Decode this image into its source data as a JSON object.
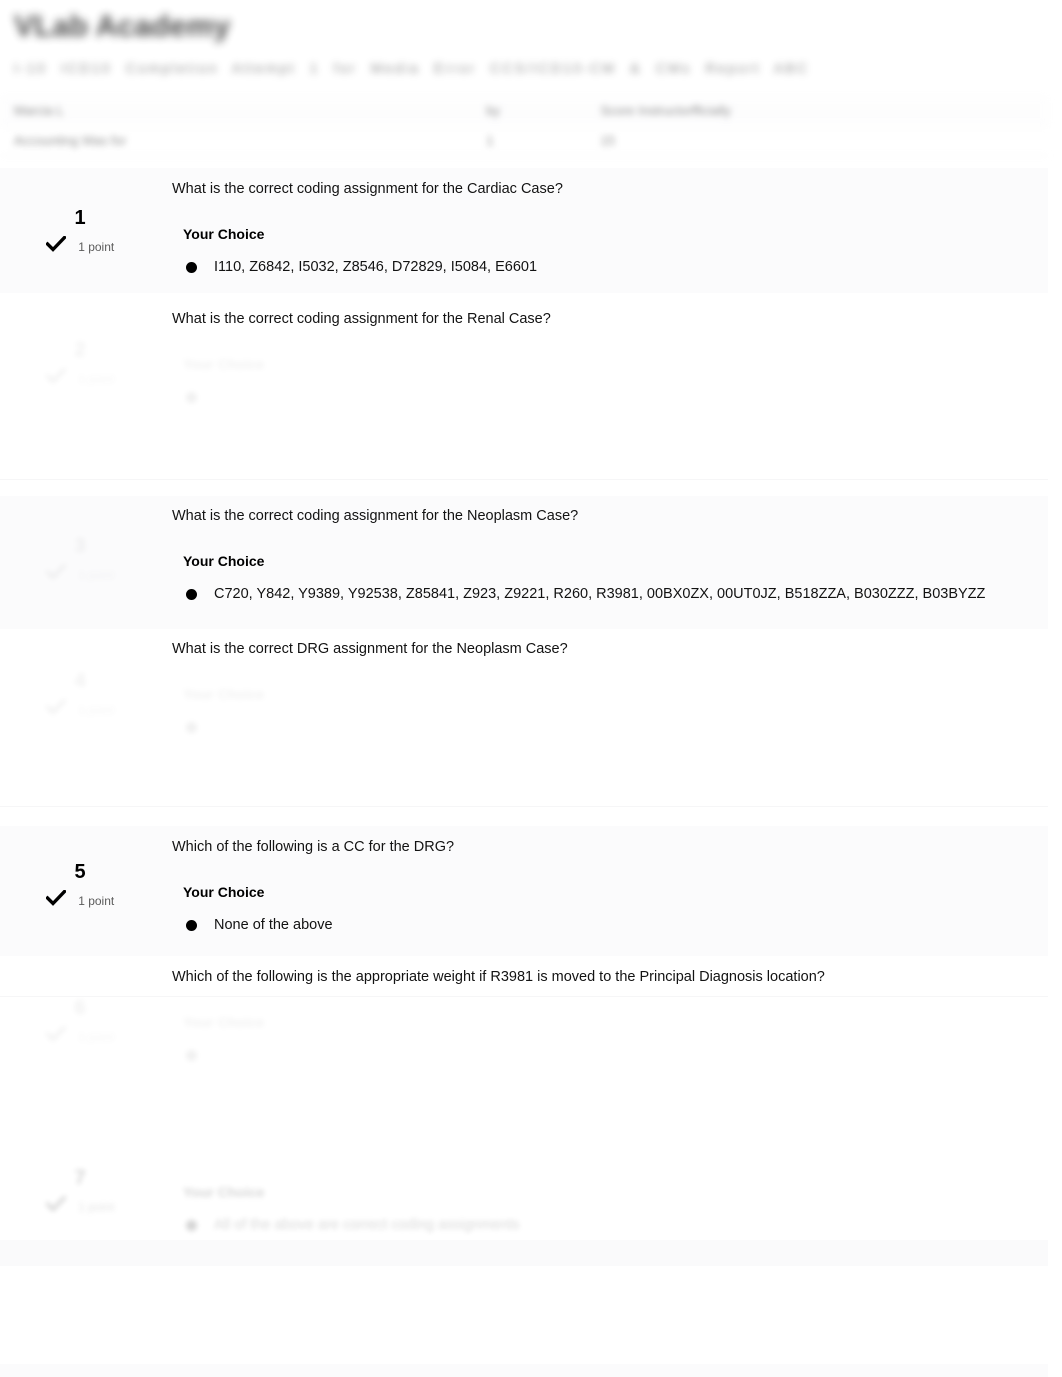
{
  "header": {
    "brand_title": "VLab Academy",
    "meta_line": "I-10 ICD10 Completion   Attempt 1 for Media Error    CCS/ICD10-CM & CMs  Report   ABC",
    "info_rows": [
      {
        "label": "Marcia L",
        "mid": "by",
        "value": "Score Instructorfficially"
      },
      {
        "label": "Accounting Was for",
        "mid": "1",
        "value": "15"
      }
    ]
  },
  "questions": [
    {
      "number": "1",
      "points": "1 point",
      "check_icon": "checkmark-icon",
      "question": "What is the correct coding assignment for the Cardiac Case?",
      "choice_label": "Your Choice",
      "answer": "I110, Z6842, I5032, Z8546, D72829, I5084, E6601",
      "state": "visible"
    },
    {
      "number": "2",
      "points": "1 point",
      "check_icon": "checkmark-icon",
      "question": "What is the correct coding assignment for the Renal Case?",
      "choice_label": "Your Choice",
      "answer": "",
      "state": "redacted"
    },
    {
      "number": "3",
      "points": "1 point",
      "check_icon": "checkmark-icon",
      "question": "What is the correct coding assignment for the Neoplasm Case?",
      "choice_label": "Your Choice",
      "answer": "C720, Y842, Y9389, Y92538, Z85841, Z923, Z9221, R260, R3981, 00BX0ZX, 00UT0JZ, B518ZZA, B030ZZZ, B03BYZZ",
      "state": "visible"
    },
    {
      "number": "4",
      "points": "1 point",
      "check_icon": "checkmark-icon",
      "question": "What is the correct DRG assignment for the Neoplasm Case?",
      "choice_label": "Your Choice",
      "answer": "",
      "state": "redacted"
    },
    {
      "number": "5",
      "points": "1 point",
      "check_icon": "checkmark-icon",
      "question": "Which of the following is a CC for the DRG?",
      "choice_label": "Your Choice",
      "answer": "None of the above",
      "state": "visible"
    },
    {
      "number": "6",
      "points": "1 point",
      "check_icon": "checkmark-icon",
      "question": "Which of the following is the appropriate weight if R3981 is moved to the Principal Diagnosis location?",
      "choice_label": "Your Choice",
      "answer": "",
      "state": "redacted"
    },
    {
      "number": "7",
      "points": "1 point",
      "check_icon": "checkmark-icon",
      "question": "",
      "choice_label": "Your Choice",
      "answer": "All of the above are correct coding assignments",
      "state": "faded"
    }
  ],
  "colors": {
    "page_background": "#ffffff",
    "band_shaded": "#fbfbfc",
    "text_primary": "#121212",
    "text_muted": "#5b5b5b",
    "bullet": "#000000"
  }
}
